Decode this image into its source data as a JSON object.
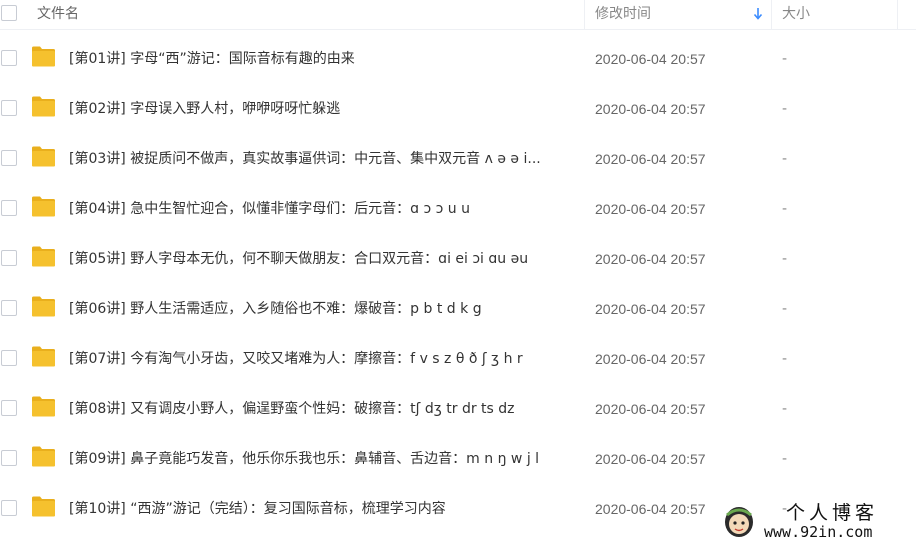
{
  "header": {
    "name_label": "文件名",
    "time_label": "修改时间",
    "size_label": "大小",
    "sort_icon": "arrow-down-icon"
  },
  "rows": [
    {
      "name": "[第01讲] 字母“西”游记：国际音标有趣的由来",
      "time": "2020-06-04 20:57",
      "size": "-"
    },
    {
      "name": "[第02讲] 字母误入野人村，咿咿呀呀忙躲逃",
      "time": "2020-06-04 20:57",
      "size": "-"
    },
    {
      "name": "[第03讲] 被捉质问不做声，真实故事逼供词：中元音、集中双元音 ʌ ə ə i...",
      "time": "2020-06-04 20:57",
      "size": "-"
    },
    {
      "name": "[第04讲] 急中生智忙迎合，似懂非懂字母们：后元音：ɑ ɔ ɔ u u",
      "time": "2020-06-04 20:57",
      "size": "-"
    },
    {
      "name": "[第05讲] 野人字母本无仇，何不聊天做朋友：合口双元音：ɑi ei ɔi ɑu əu",
      "time": "2020-06-04 20:57",
      "size": "-"
    },
    {
      "name": "[第06讲] 野人生活需适应，入乡随俗也不难：爆破音：p b t d k g",
      "time": "2020-06-04 20:57",
      "size": "-"
    },
    {
      "name": "[第07讲] 今有淘气小牙齿，又咬又堵难为人：摩擦音：f v s z θ  ð ʃ ʒ h r",
      "time": "2020-06-04 20:57",
      "size": "-"
    },
    {
      "name": "[第08讲] 又有调皮小野人，偏逞野蛮个性妈：破擦音：tʃ dʒ tr dr ts dz",
      "time": "2020-06-04 20:57",
      "size": "-"
    },
    {
      "name": "[第09讲] 鼻子竟能巧发音，他乐你乐我也乐：鼻辅音、舌边音：m n ŋ w j l",
      "time": "2020-06-04 20:57",
      "size": "-"
    },
    {
      "name": "[第10讲] “西游”游记（完结）：复习国际音标，梳理学习内容",
      "time": "2020-06-04 20:57",
      "size": "-"
    }
  ],
  "watermark": {
    "title": "个人博客",
    "url": "www.92in.com"
  },
  "colors": {
    "folder": "#F5C12E",
    "accent": "#3B8CFF",
    "divider": "#EEF0F4"
  }
}
